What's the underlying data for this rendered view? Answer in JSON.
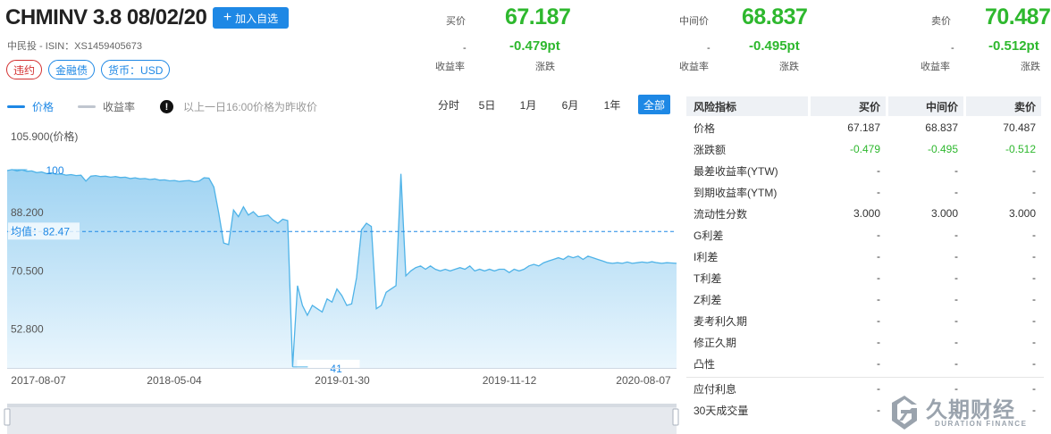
{
  "header": {
    "title": "CHMINV 3.8 08/02/20",
    "add_label": "加入自选",
    "subline": "中民投 - ISIN：XS1459405673",
    "tags": [
      "违约",
      "金融债",
      "货币：USD"
    ]
  },
  "quotes": {
    "bid": {
      "label": "买价",
      "price": "67.187",
      "ytm": "-",
      "change": "-0.479pt",
      "ytm_label": "收益率",
      "change_label": "涨跌"
    },
    "mid": {
      "label": "中间价",
      "price": "68.837",
      "ytm": "-",
      "change": "-0.495pt",
      "ytm_label": "收益率",
      "change_label": "涨跌"
    },
    "ask": {
      "label": "卖价",
      "price": "70.487",
      "ytm": "-",
      "change": "-0.512pt",
      "ytm_label": "收益率",
      "change_label": "涨跌"
    }
  },
  "toolbar": {
    "legend_price": "价格",
    "legend_yield": "收益率",
    "notice": "以上一日16:00价格为昨收价",
    "ranges": [
      "分时",
      "5日",
      "1月",
      "6月",
      "1年",
      "全部"
    ],
    "active_range": "全部"
  },
  "chart_data": {
    "type": "area",
    "ylabel": "105.900(价格)",
    "y_ticks": [
      "88.200",
      "70.500",
      "52.800"
    ],
    "x_ticks": [
      "2017-08-07",
      "2018-05-04",
      "2019-01-30",
      "2019-11-12",
      "2020-08-07"
    ],
    "average_label": "均值：82.47",
    "average": 82.47,
    "max_label": "100",
    "min_label": "41",
    "ylim": [
      41,
      105.9
    ],
    "series": [
      {
        "values": [
          101.0,
          101.3,
          100.9,
          101.2,
          100.8,
          100.9,
          100.4,
          100.6,
          100.1,
          100.3,
          99.9,
          100.0,
          99.6,
          99.8,
          99.5,
          99.6,
          97.8,
          99.3,
          99.5,
          99.2,
          99.3,
          99.0,
          99.2,
          98.9,
          99.0,
          98.6,
          98.8,
          98.5,
          98.6,
          98.3,
          98.5,
          98.1,
          98.2,
          97.9,
          98.0,
          97.7,
          97.9,
          98.0,
          97.6,
          97.8,
          98.8,
          98.7,
          96.0,
          88.0,
          79.0,
          78.5,
          89.0,
          87.0,
          90.0,
          87.5,
          88.5,
          87.0,
          87.2,
          87.5,
          86.0,
          85.0,
          86.2,
          85.8,
          41.3,
          66.0,
          60.0,
          57.0,
          60.0,
          59.0,
          58.0,
          62.0,
          61.0,
          65.0,
          63.0,
          60.0,
          60.5,
          68.5,
          83.0,
          85.0,
          84.0,
          59.0,
          60.0,
          64.0,
          65.0,
          66.0,
          100.0,
          69.0,
          70.5,
          71.5,
          72.0,
          71.0,
          72.0,
          71.0,
          70.5,
          71.0,
          70.5,
          71.0,
          71.5,
          71.0,
          72.0,
          70.5,
          71.0,
          70.5,
          71.0,
          70.5,
          71.0,
          71.0,
          70.0,
          71.0,
          70.5,
          71.0,
          72.0,
          72.5,
          72.0,
          73.0,
          73.5,
          74.0,
          74.5,
          74.0,
          75.0,
          74.5,
          75.0,
          74.0,
          75.0,
          74.5,
          74.0,
          73.5,
          73.0,
          72.8,
          73.0,
          72.8,
          73.2,
          72.8,
          73.0,
          73.2,
          73.0,
          73.3,
          73.0,
          72.8,
          73.0,
          72.9,
          72.8
        ]
      }
    ]
  },
  "risk_panel": {
    "headers": [
      "风险指标",
      "买价",
      "中间价",
      "卖价"
    ],
    "rows": [
      {
        "name": "价格",
        "bid": "67.187",
        "mid": "68.837",
        "ask": "70.487",
        "green": false
      },
      {
        "name": "涨跌额",
        "bid": "-0.479",
        "mid": "-0.495",
        "ask": "-0.512",
        "green": true
      },
      {
        "name": "最差收益率(YTW)",
        "bid": "-",
        "mid": "-",
        "ask": "-",
        "green": false
      },
      {
        "name": "到期收益率(YTM)",
        "bid": "-",
        "mid": "-",
        "ask": "-",
        "green": false
      },
      {
        "name": "流动性分数",
        "bid": "3.000",
        "mid": "3.000",
        "ask": "3.000",
        "green": false
      },
      {
        "name": "G利差",
        "bid": "-",
        "mid": "-",
        "ask": "-",
        "green": false
      },
      {
        "name": "I利差",
        "bid": "-",
        "mid": "-",
        "ask": "-",
        "green": false
      },
      {
        "name": "T利差",
        "bid": "-",
        "mid": "-",
        "ask": "-",
        "green": false
      },
      {
        "name": "Z利差",
        "bid": "-",
        "mid": "-",
        "ask": "-",
        "green": false
      },
      {
        "name": "麦考利久期",
        "bid": "-",
        "mid": "-",
        "ask": "-",
        "green": false
      },
      {
        "name": "修正久期",
        "bid": "-",
        "mid": "-",
        "ask": "-",
        "green": false
      },
      {
        "name": "凸性",
        "bid": "-",
        "mid": "-",
        "ask": "-",
        "green": false
      }
    ],
    "extra_rows": [
      {
        "name": "应付利息",
        "bid": "-",
        "mid": "-",
        "ask": "-"
      },
      {
        "name": "30天成交量",
        "bid": "-",
        "mid": "-",
        "ask": "-"
      }
    ]
  },
  "watermark": {
    "text": "久期财经",
    "sub": "DURATION FINANCE"
  },
  "colors": {
    "accent": "#1e88e5",
    "green": "#2eb82e",
    "red": "#d32f2f",
    "area": "#bfe3f7",
    "line": "#4fb3e8"
  }
}
